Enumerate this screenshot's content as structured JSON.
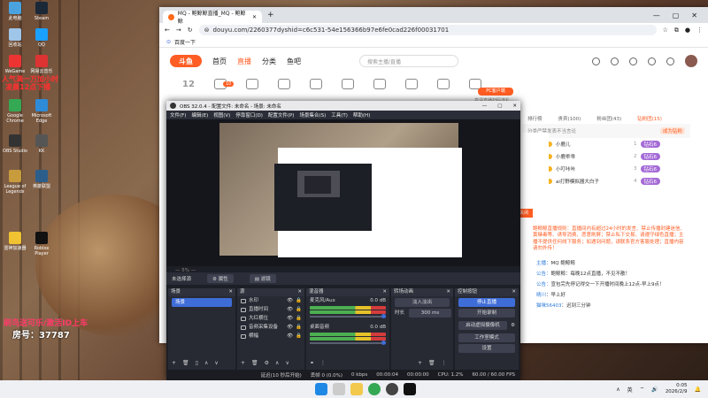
{
  "desktop": {
    "icons": [
      {
        "label": "此电脑",
        "color": "#4aa3df"
      },
      {
        "label": "Steam",
        "color": "#1b2838"
      },
      {
        "label": "回收站",
        "color": "#9fc5e8"
      },
      {
        "label": "QQ",
        "color": "#1aa0ff"
      },
      {
        "label": "WeGame",
        "color": "#e33"
      },
      {
        "label": "网易云音乐",
        "color": "#d33"
      },
      {
        "label": "Google Chrome",
        "color": "#34a853"
      },
      {
        "label": "Microsoft Edge",
        "color": "#2e8bd8"
      },
      {
        "label": "OBS Studio",
        "color": "#333"
      },
      {
        "label": "KK",
        "color": "#555"
      },
      {
        "label": "League of Legends",
        "color": "#c89b3c"
      },
      {
        "label": "英雄联盟",
        "color": "#2c5e8c"
      },
      {
        "label": "雷神加速器",
        "color": "#f1c232"
      },
      {
        "label": "Roblox Player",
        "color": "#111"
      }
    ],
    "overlay_line1": "人气满一万加小时",
    "overlay_line2": "凌晨12点下播",
    "overlay_invite": "刷鸟送可乐/激活ID上车",
    "overlay_room": "房号：37787"
  },
  "browser": {
    "tab_title": "MQ - 鲍鲸鲸直播_MQ - 鲍鲸鲸",
    "url": "douyu.com/2260377dyshid=c6c531-54e156366b97e6fe0cad226f00031701",
    "bookmark": "百度一下",
    "nav": [
      "首页",
      "直播",
      "分类",
      "鱼吧"
    ],
    "search_placeholder": "搜索主播/直播",
    "room_number": "12",
    "badge": "10",
    "pc_button": "PC客户端",
    "pc_sub": "高清直播扫码送礼",
    "panel": {
      "tabs": [
        "排行榜",
        "贵宾",
        "粉丝团",
        "钻粉团"
      ],
      "tab_counts": [
        "(100)",
        "(43)",
        "(15)"
      ],
      "notice": "分类严禁发表不当言论",
      "notice_tag": "成为钻粉",
      "fans": [
        {
          "name": "小鹿儿",
          "badge": "钻石6",
          "count": "1"
        },
        {
          "name": "小鹿乖乖",
          "badge": "钻石6",
          "count": "2"
        },
        {
          "name": "小叮咔咔",
          "badge": "钻石6",
          "count": "3"
        },
        {
          "name": "ai打野模拟器大白子",
          "badge": "钻石6",
          "count": "4"
        }
      ],
      "rules": "鲍鲸鲸直播规则：直播间内有超过24小时的发言、禁止传播封建迷信、黄赌毒等、诱导消费、恶意刷屏；禁止私下交易、请遵守绿色直播；主播不提供任何线下服务；如遇到问题，请联系官方客服处理；直播内容请勿外传！",
      "chat": [
        {
          "user": "主播：",
          "text": "MQ 鲍鲸鲸"
        },
        {
          "user": "公告：",
          "text": "鲍鲸鲸：每晚12点直播，不见不散！"
        },
        {
          "user": "公告：",
          "text": "宣包完先停记得交一下开播时间晚上12点-早上9点！"
        },
        {
          "user": "晴川",
          "text": "：早上好"
        },
        {
          "user": "猫咪56403",
          "text": "：迟到三分钟"
        }
      ]
    }
  },
  "obs": {
    "title": "OBS 32.0.4 - 配置文件: 未命名 - 场景: 未命名",
    "menu": [
      "文件(F)",
      "编辑(E)",
      "视图(V)",
      "停靠窗口(D)",
      "配置文件(P)",
      "场景集合(S)",
      "工具(T)",
      "帮助(H)"
    ],
    "no_source": "未选择源",
    "props": "属性",
    "filters": "滤镜",
    "docks": {
      "scenes": {
        "title": "场景",
        "items": [
          "场景"
        ]
      },
      "sources": {
        "title": "源",
        "items": [
          "水印",
          "直播时间",
          "大红横位",
          "音频采集设备",
          "横幅"
        ]
      },
      "mixer": {
        "title": "混音器",
        "channels": [
          {
            "name": "麦克风/Aux",
            "db": "0.0 dB"
          },
          {
            "name": "桌面音频",
            "db": "0.0 dB"
          }
        ]
      },
      "transitions": {
        "title": "转场动画",
        "type": "淡入淡出",
        "duration_label": "时长",
        "duration": "300 ms"
      },
      "controls": {
        "title": "控制按钮",
        "buttons": [
          "停止直播",
          "开始录制",
          "启动虚拟摄像机",
          "工作室模式",
          "设置"
        ]
      }
    },
    "status": [
      "延迟(10 秒后开始)",
      "丢帧 0 (0.0%)",
      "0 kbps",
      "00:00:04",
      "00:00:00",
      "CPU: 1.2%",
      "60.00 / 60.00 FPS"
    ]
  },
  "taskbar": {
    "lang": "英",
    "time": "0:05",
    "date": "2026/2/9"
  }
}
